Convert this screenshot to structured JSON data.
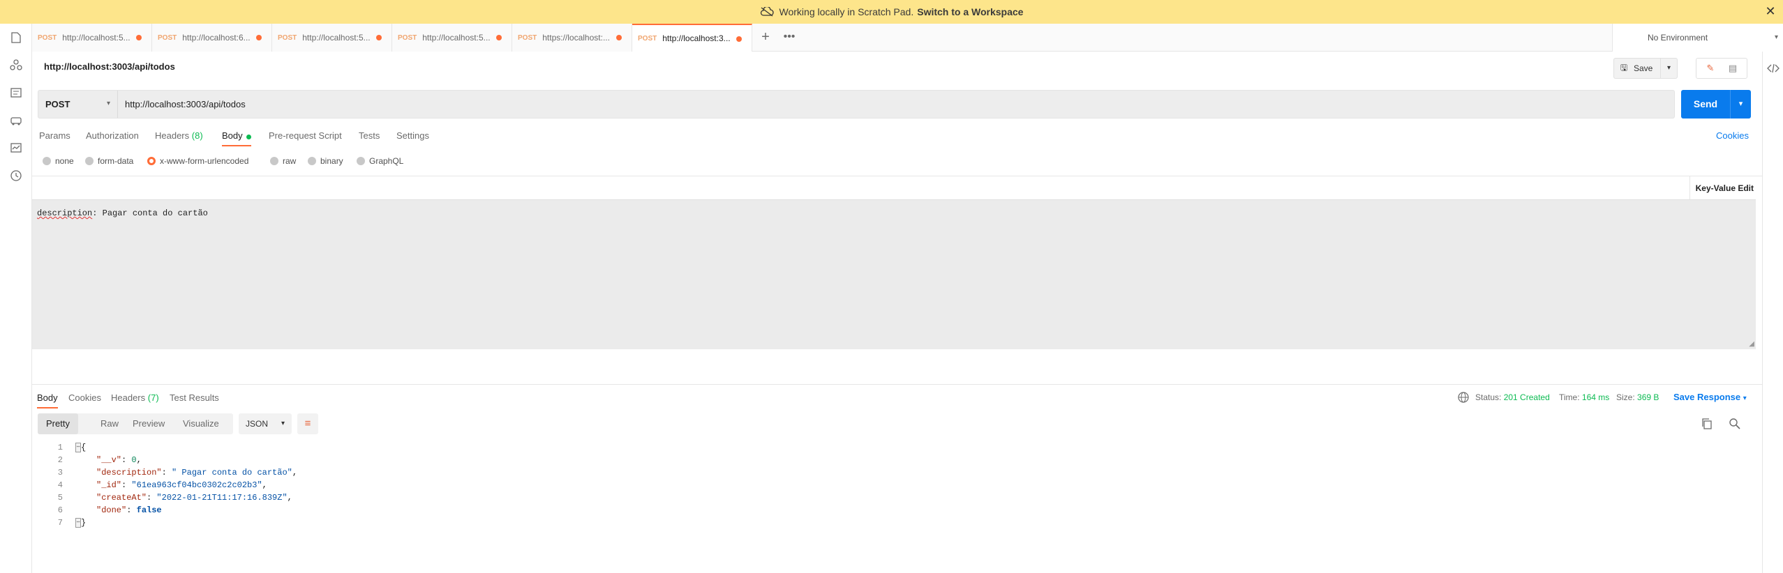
{
  "banner": {
    "message": "Working locally in Scratch Pad.",
    "link": "Switch to a Workspace",
    "bg": "#fde58b"
  },
  "tabs": [
    {
      "method": "POST",
      "url": "http://localhost:5..."
    },
    {
      "method": "POST",
      "url": "http://localhost:6..."
    },
    {
      "method": "POST",
      "url": "http://localhost:5..."
    },
    {
      "method": "POST",
      "url": "http://localhost:5..."
    },
    {
      "method": "POST",
      "url": "https://localhost:..."
    },
    {
      "method": "POST",
      "url": "http://localhost:3..."
    }
  ],
  "environment": {
    "selected": "No Environment"
  },
  "request": {
    "name": "http://localhost:3003/api/todos",
    "save_label": "Save",
    "method": "POST",
    "url": "http://localhost:3003/api/todos",
    "send_label": "Send",
    "cookies_label": "Cookies",
    "tabs": {
      "params": "Params",
      "authorization": "Authorization",
      "headers": "Headers",
      "headers_count": "(8)",
      "body": "Body",
      "prerequest": "Pre-request Script",
      "tests": "Tests",
      "settings": "Settings"
    },
    "body_types": {
      "none": "none",
      "form_data": "form-data",
      "urlencoded": "x-www-form-urlencoded",
      "raw": "raw",
      "binary": "binary",
      "graphql": "GraphQL"
    },
    "selected_body_type": "x-www-form-urlencoded",
    "kv_edit_label": "Key-Value Edit",
    "bulk": {
      "key": "description",
      "separator": ": ",
      "value": "Pagar conta do cartão"
    }
  },
  "response": {
    "tabs": {
      "body": "Body",
      "cookies": "Cookies",
      "headers": "Headers",
      "headers_count": "(7)",
      "test_results": "Test Results"
    },
    "status_label": "Status:",
    "status_value": "201 Created",
    "time_label": "Time:",
    "time_value": "164 ms",
    "size_label": "Size:",
    "size_value": "369 B",
    "save_response": "Save Response",
    "views": {
      "pretty": "Pretty",
      "raw": "Raw",
      "preview": "Preview",
      "visualize": "Visualize"
    },
    "format": "JSON",
    "code": {
      "line_numbers": [
        "1",
        "2",
        "3",
        "4",
        "5",
        "6",
        "7"
      ],
      "open": "{",
      "close": "}",
      "fields": [
        {
          "key": "\"__v\"",
          "value": "0",
          "comma": ","
        },
        {
          "key": "\"description\"",
          "value": "\" Pagar conta do cartão\"",
          "comma": ","
        },
        {
          "key": "\"_id\"",
          "value": "\"61ea963cf04bc0302c2c02b3\"",
          "comma": ","
        },
        {
          "key": "\"createAt\"",
          "value": "\"2022-01-21T11:17:16.839Z\"",
          "comma": ","
        },
        {
          "key": "\"done\"",
          "value": "false",
          "comma": ""
        }
      ]
    }
  },
  "colors": {
    "accent": "#ff6c37",
    "send": "#097bed",
    "success": "#0cbb52"
  }
}
